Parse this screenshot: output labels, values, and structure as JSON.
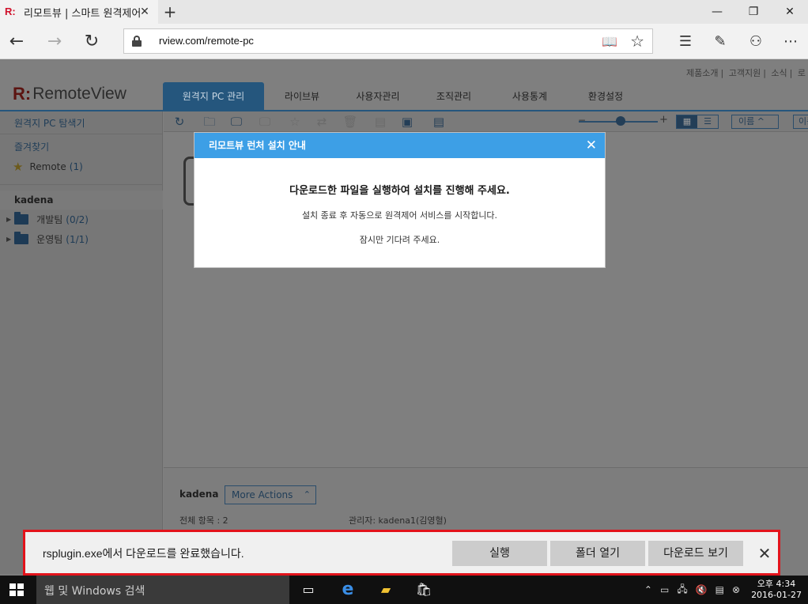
{
  "browser": {
    "tab_title": "리모트뷰 | 스마트 원격제어",
    "favicon_text": "R:",
    "url": "rview.com/remote-pc"
  },
  "page": {
    "top_links": [
      "제품소개",
      "고객지원",
      "소식",
      "로"
    ],
    "brand_mark": "R:",
    "brand_name": "RemoteView",
    "main_tabs": [
      {
        "label": "원격지 PC 관리",
        "active": true
      },
      {
        "label": "라이브뷰",
        "active": false
      },
      {
        "label": "사용자관리",
        "active": false
      },
      {
        "label": "조직관리",
        "active": false
      },
      {
        "label": "사용통계",
        "active": false
      },
      {
        "label": "환경설정",
        "active": false
      }
    ],
    "sidebar": {
      "search_label": "원격지 PC 탐색기",
      "favorites_label": "즐겨찾기",
      "favorite_item": {
        "label": "Remote",
        "count": "(1)"
      },
      "org_name": "kadena",
      "groups": [
        {
          "label": "개발팀",
          "count": "(0/2)"
        },
        {
          "label": "운영팀",
          "count": "(1/1)"
        }
      ]
    },
    "toolbar": {
      "sort_label": "이름",
      "sort_label_2": "이름"
    },
    "bottom_panel": {
      "name": "kadena",
      "more_actions": "More Actions",
      "total_items": "전체 항목 : 2",
      "admin": "관리자: kadena1(김영혈)"
    }
  },
  "modal": {
    "title": "리모트뷰 런처 설치 안내",
    "line1": "다운로드한 파일을 실행하여 설치를 진행해 주세요.",
    "line2": "설치 종료 후 자동으로 원격제어 서비스를 시작합니다.",
    "line3": "잠시만 기다려 주세요."
  },
  "download_bar": {
    "message": "rsplugin.exe에서 다운로드를 완료했습니다.",
    "run_label": "실행",
    "open_folder_label": "폴더 열기",
    "view_downloads_label": "다운로드 보기"
  },
  "taskbar": {
    "search_placeholder": "웹 및 Windows 검색",
    "time": "오후 4:34",
    "date": "2016-01-27"
  }
}
